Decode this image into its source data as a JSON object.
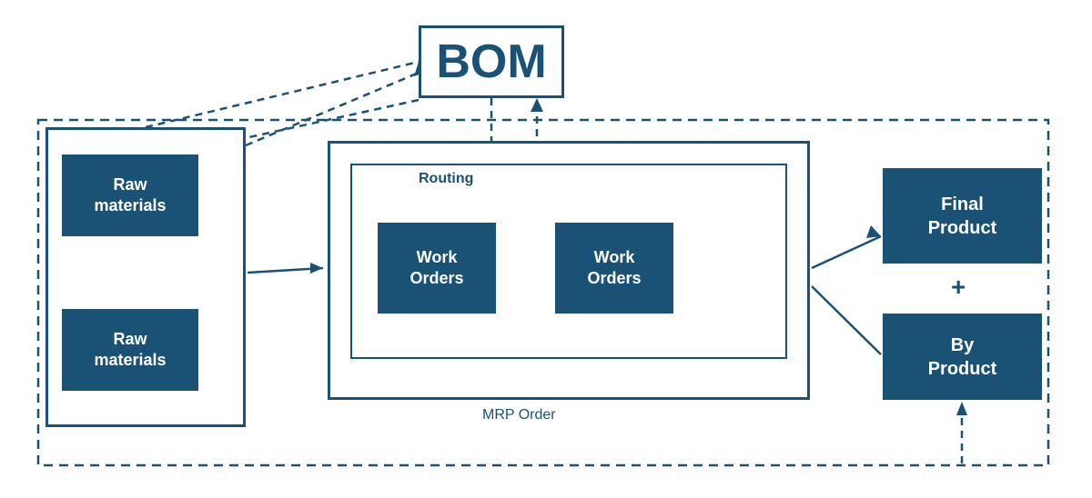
{
  "bom": {
    "label": "BOM"
  },
  "raw_materials_1": {
    "label": "Raw\nmaterials"
  },
  "raw_materials_2": {
    "label": "Raw\nmaterials"
  },
  "routing": {
    "label": "Routing"
  },
  "work_orders_1": {
    "label": "Work\nOrders"
  },
  "work_orders_2": {
    "label": "Work\nOrders"
  },
  "mrp_order": {
    "label": "MRP Order"
  },
  "final_product": {
    "label": "Final\nProduct"
  },
  "by_product": {
    "label": "By\nProduct"
  },
  "plus": {
    "label": "+"
  },
  "colors": {
    "primary": "#1a5276",
    "white": "#ffffff"
  }
}
